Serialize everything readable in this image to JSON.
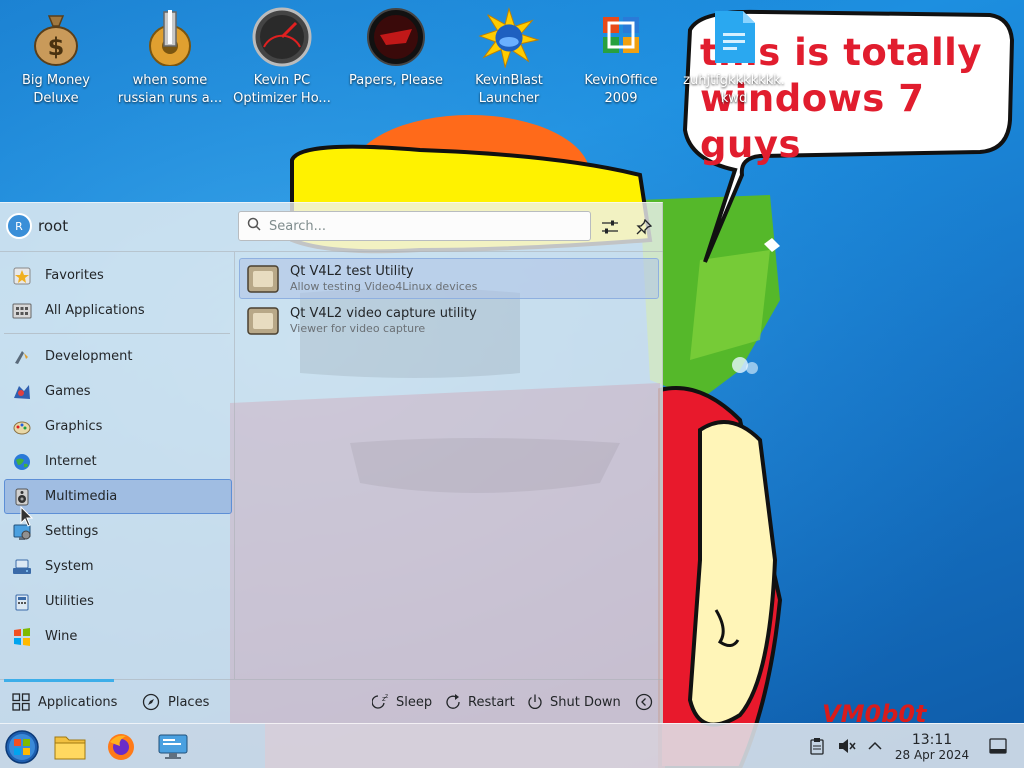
{
  "desktop": {
    "icons": [
      {
        "line1": "Big Money",
        "line2": "Deluxe"
      },
      {
        "line1": "when some",
        "line2": "russian runs a..."
      },
      {
        "line1": "Kevin PC",
        "line2": "Optimizer Ho..."
      },
      {
        "line1": "Papers, Please",
        "line2": ""
      },
      {
        "line1": "KevinBlast",
        "line2": "Launcher"
      },
      {
        "line1": "KevinOffice",
        "line2": "2009"
      },
      {
        "line1": "zuhjtfgkkkkkkk.",
        "line2": "kwd"
      }
    ],
    "wallpaper": {
      "speech_line1": "this is totally",
      "speech_line2": "windows 7 guys",
      "signature": "VM0b0t"
    }
  },
  "launcher": {
    "user": {
      "initial": "R",
      "name": "root"
    },
    "search": {
      "placeholder": "Search..."
    },
    "favorites_label": "Favorites",
    "all_apps_label": "All Applications",
    "categories": [
      {
        "label": "Development",
        "icon": "development-icon"
      },
      {
        "label": "Games",
        "icon": "games-icon"
      },
      {
        "label": "Graphics",
        "icon": "graphics-icon"
      },
      {
        "label": "Internet",
        "icon": "internet-icon"
      },
      {
        "label": "Multimedia",
        "icon": "multimedia-icon"
      },
      {
        "label": "Settings",
        "icon": "settings-icon"
      },
      {
        "label": "System",
        "icon": "system-icon"
      },
      {
        "label": "Utilities",
        "icon": "utilities-icon"
      },
      {
        "label": "Wine",
        "icon": "wine-icon"
      }
    ],
    "selected_category": "Multimedia",
    "apps": [
      {
        "name": "Qt V4L2 test Utility",
        "description": "Allow testing Video4Linux devices"
      },
      {
        "name": "Qt V4L2 video capture utility",
        "description": "Viewer for video capture"
      }
    ],
    "footer": {
      "applications_tab": "Applications",
      "places_tab": "Places",
      "sleep": "Sleep",
      "restart": "Restart",
      "shutdown": "Shut Down"
    }
  },
  "taskbar": {
    "clock_time": "13:11",
    "clock_date": "28 Apr 2024"
  },
  "colors": {
    "accent": "#3daee9",
    "selection": "#5d8fd6",
    "desktop_blue": "#1d8fe0",
    "speech_text": "#e11d2e"
  }
}
